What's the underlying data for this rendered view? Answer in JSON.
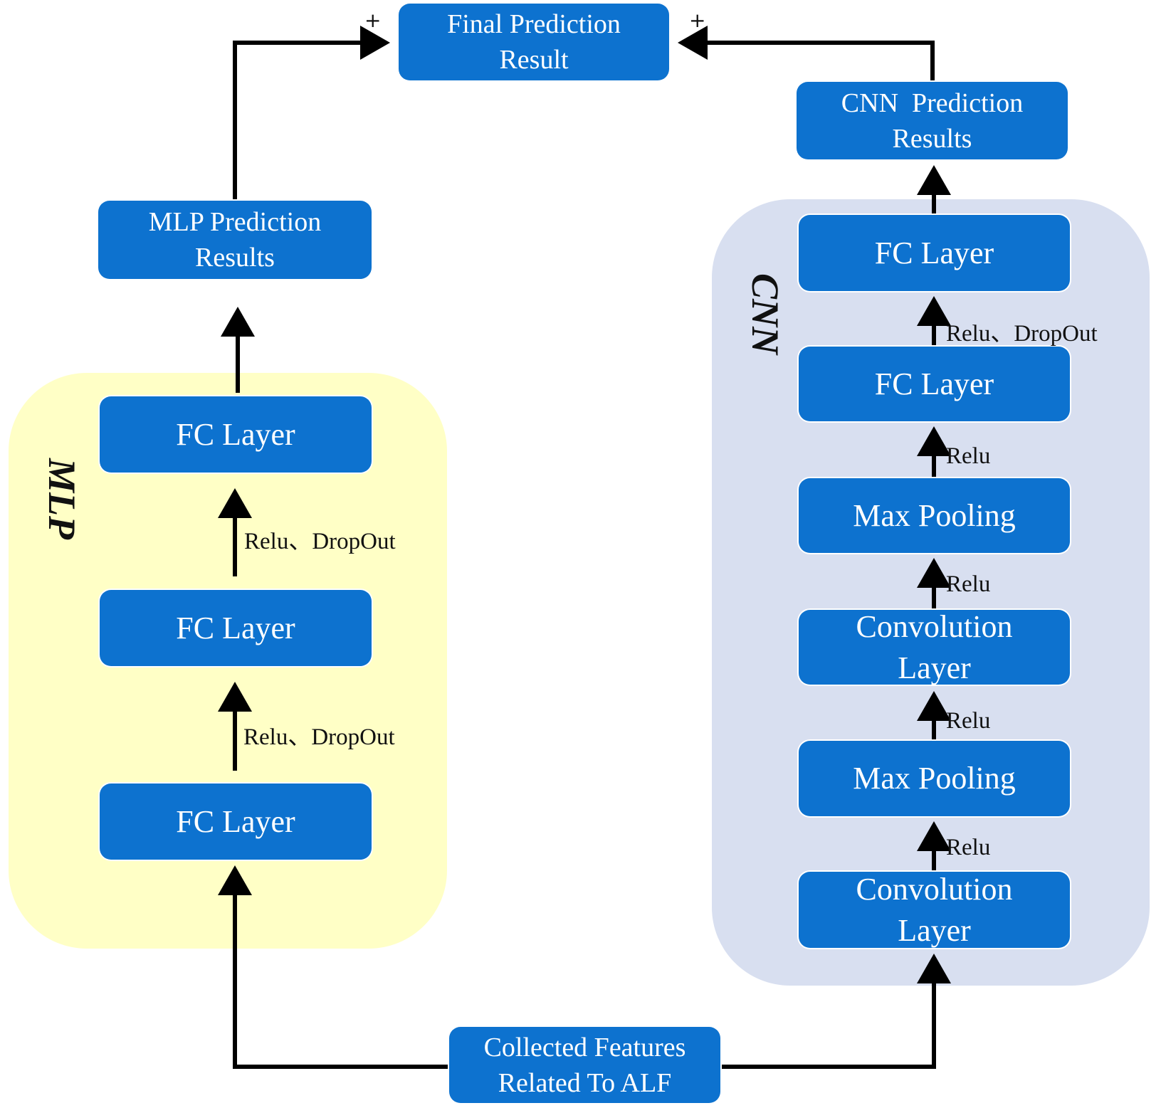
{
  "final": {
    "label": "Final Prediction Result",
    "plus_left": "+",
    "plus_right": "+"
  },
  "mlp": {
    "group_label": "MLP",
    "output_label": "MLP Prediction Results",
    "layers": [
      "FC Layer",
      "FC Layer",
      "FC Layer"
    ],
    "activations": [
      "Relu、DropOut",
      "Relu、DropOut"
    ]
  },
  "cnn": {
    "group_label": "CNN",
    "output_label": "CNN  Prediction Results",
    "layers": [
      "FC Layer",
      "FC Layer",
      "Max Pooling",
      "Convolution Layer",
      "Max Pooling",
      "Convolution Layer"
    ],
    "activations": [
      "Relu、DropOut",
      "Relu",
      "Relu",
      "Relu",
      "Relu"
    ]
  },
  "input": {
    "label": "Collected Features Related To ALF"
  },
  "colors": {
    "box": "#0d72cf",
    "mlp_bg": "#ffffc6",
    "cnn_bg": "#d8dff0",
    "wire": "#000000"
  }
}
